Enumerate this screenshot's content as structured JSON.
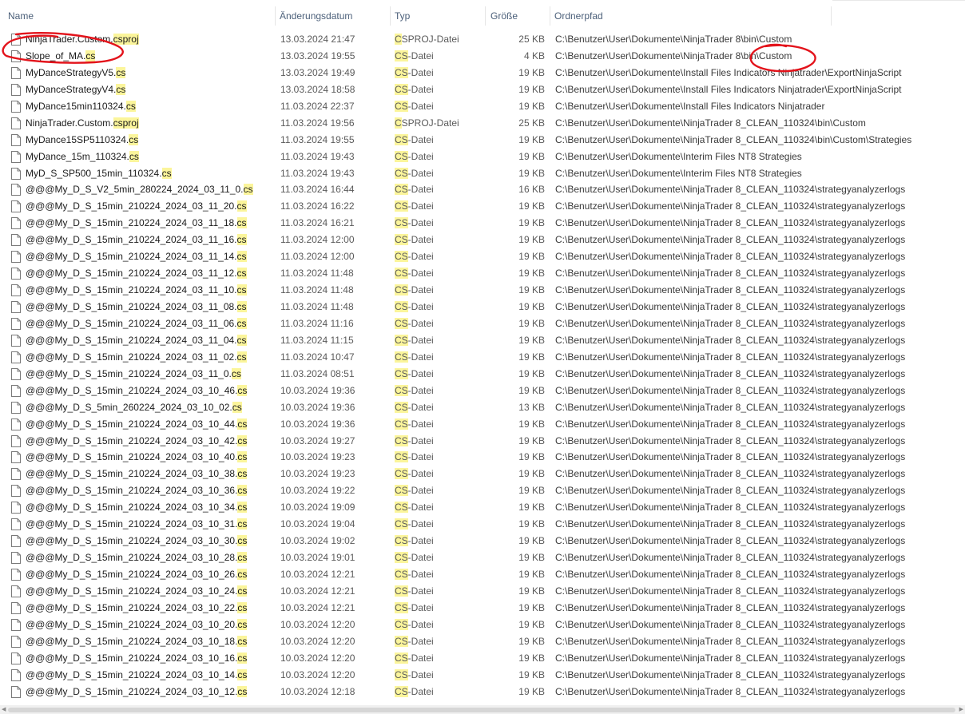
{
  "columns": {
    "name": "Name",
    "date": "Änderungsdatum",
    "type": "Typ",
    "size": "Größe",
    "path": "Ordnerpfad"
  },
  "files": [
    {
      "base": "NinjaTrader.Custom.",
      "ext": "csproj",
      "date": "13.03.2024 21:47",
      "type_hl": "C",
      "type_rest": "SPROJ-Datei",
      "size": "25 KB",
      "path": "C:\\Benutzer\\User\\Dokumente\\NinjaTrader 8\\bin\\Custom"
    },
    {
      "base": "Slope_of_MA.",
      "ext": "cs",
      "date": "13.03.2024 19:55",
      "type_hl": "CS",
      "type_rest": "-Datei",
      "size": "4 KB",
      "path": "C:\\Benutzer\\User\\Dokumente\\NinjaTrader 8\\bin\\Custom"
    },
    {
      "base": "MyDanceStrategyV5.",
      "ext": "cs",
      "date": "13.03.2024 19:49",
      "type_hl": "CS",
      "type_rest": "-Datei",
      "size": "19 KB",
      "path": "C:\\Benutzer\\User\\Dokumente\\Install Files Indicators Ninjatrader\\ExportNinjaScript"
    },
    {
      "base": "MyDanceStrategyV4.",
      "ext": "cs",
      "date": "13.03.2024 18:58",
      "type_hl": "CS",
      "type_rest": "-Datei",
      "size": "19 KB",
      "path": "C:\\Benutzer\\User\\Dokumente\\Install Files Indicators Ninjatrader\\ExportNinjaScript"
    },
    {
      "base": "MyDance15min110324.",
      "ext": "cs",
      "date": "11.03.2024 22:37",
      "type_hl": "CS",
      "type_rest": "-Datei",
      "size": "19 KB",
      "path": "C:\\Benutzer\\User\\Dokumente\\Install Files Indicators Ninjatrader"
    },
    {
      "base": "NinjaTrader.Custom.",
      "ext": "csproj",
      "date": "11.03.2024 19:56",
      "type_hl": "C",
      "type_rest": "SPROJ-Datei",
      "size": "25 KB",
      "path": "C:\\Benutzer\\User\\Dokumente\\NinjaTrader 8_CLEAN_110324\\bin\\Custom"
    },
    {
      "base": "MyDance15SP5110324.",
      "ext": "cs",
      "date": "11.03.2024 19:55",
      "type_hl": "CS",
      "type_rest": "-Datei",
      "size": "19 KB",
      "path": "C:\\Benutzer\\User\\Dokumente\\NinjaTrader 8_CLEAN_110324\\bin\\Custom\\Strategies"
    },
    {
      "base": "MyDance_15m_110324.",
      "ext": "cs",
      "date": "11.03.2024 19:43",
      "type_hl": "CS",
      "type_rest": "-Datei",
      "size": "19 KB",
      "path": "C:\\Benutzer\\User\\Dokumente\\Interim Files NT8 Strategies"
    },
    {
      "base": "MyD_S_SP500_15min_110324.",
      "ext": "cs",
      "date": "11.03.2024 19:43",
      "type_hl": "CS",
      "type_rest": "-Datei",
      "size": "19 KB",
      "path": "C:\\Benutzer\\User\\Dokumente\\Interim Files NT8 Strategies"
    },
    {
      "base": "@@@My_D_S_V2_5min_280224_2024_03_11_0.",
      "ext": "cs",
      "date": "11.03.2024 16:44",
      "type_hl": "CS",
      "type_rest": "-Datei",
      "size": "16 KB",
      "path": "C:\\Benutzer\\User\\Dokumente\\NinjaTrader 8_CLEAN_110324\\strategyanalyzerlogs"
    },
    {
      "base": "@@@My_D_S_15min_210224_2024_03_11_20.",
      "ext": "cs",
      "date": "11.03.2024 16:22",
      "type_hl": "CS",
      "type_rest": "-Datei",
      "size": "19 KB",
      "path": "C:\\Benutzer\\User\\Dokumente\\NinjaTrader 8_CLEAN_110324\\strategyanalyzerlogs"
    },
    {
      "base": "@@@My_D_S_15min_210224_2024_03_11_18.",
      "ext": "cs",
      "date": "11.03.2024 16:21",
      "type_hl": "CS",
      "type_rest": "-Datei",
      "size": "19 KB",
      "path": "C:\\Benutzer\\User\\Dokumente\\NinjaTrader 8_CLEAN_110324\\strategyanalyzerlogs"
    },
    {
      "base": "@@@My_D_S_15min_210224_2024_03_11_16.",
      "ext": "cs",
      "date": "11.03.2024 12:00",
      "type_hl": "CS",
      "type_rest": "-Datei",
      "size": "19 KB",
      "path": "C:\\Benutzer\\User\\Dokumente\\NinjaTrader 8_CLEAN_110324\\strategyanalyzerlogs"
    },
    {
      "base": "@@@My_D_S_15min_210224_2024_03_11_14.",
      "ext": "cs",
      "date": "11.03.2024 12:00",
      "type_hl": "CS",
      "type_rest": "-Datei",
      "size": "19 KB",
      "path": "C:\\Benutzer\\User\\Dokumente\\NinjaTrader 8_CLEAN_110324\\strategyanalyzerlogs"
    },
    {
      "base": "@@@My_D_S_15min_210224_2024_03_11_12.",
      "ext": "cs",
      "date": "11.03.2024 11:48",
      "type_hl": "CS",
      "type_rest": "-Datei",
      "size": "19 KB",
      "path": "C:\\Benutzer\\User\\Dokumente\\NinjaTrader 8_CLEAN_110324\\strategyanalyzerlogs"
    },
    {
      "base": "@@@My_D_S_15min_210224_2024_03_11_10.",
      "ext": "cs",
      "date": "11.03.2024 11:48",
      "type_hl": "CS",
      "type_rest": "-Datei",
      "size": "19 KB",
      "path": "C:\\Benutzer\\User\\Dokumente\\NinjaTrader 8_CLEAN_110324\\strategyanalyzerlogs"
    },
    {
      "base": "@@@My_D_S_15min_210224_2024_03_11_08.",
      "ext": "cs",
      "date": "11.03.2024 11:48",
      "type_hl": "CS",
      "type_rest": "-Datei",
      "size": "19 KB",
      "path": "C:\\Benutzer\\User\\Dokumente\\NinjaTrader 8_CLEAN_110324\\strategyanalyzerlogs"
    },
    {
      "base": "@@@My_D_S_15min_210224_2024_03_11_06.",
      "ext": "cs",
      "date": "11.03.2024 11:16",
      "type_hl": "CS",
      "type_rest": "-Datei",
      "size": "19 KB",
      "path": "C:\\Benutzer\\User\\Dokumente\\NinjaTrader 8_CLEAN_110324\\strategyanalyzerlogs"
    },
    {
      "base": "@@@My_D_S_15min_210224_2024_03_11_04.",
      "ext": "cs",
      "date": "11.03.2024 11:15",
      "type_hl": "CS",
      "type_rest": "-Datei",
      "size": "19 KB",
      "path": "C:\\Benutzer\\User\\Dokumente\\NinjaTrader 8_CLEAN_110324\\strategyanalyzerlogs"
    },
    {
      "base": "@@@My_D_S_15min_210224_2024_03_11_02.",
      "ext": "cs",
      "date": "11.03.2024 10:47",
      "type_hl": "CS",
      "type_rest": "-Datei",
      "size": "19 KB",
      "path": "C:\\Benutzer\\User\\Dokumente\\NinjaTrader 8_CLEAN_110324\\strategyanalyzerlogs"
    },
    {
      "base": "@@@My_D_S_15min_210224_2024_03_11_0.",
      "ext": "cs",
      "date": "11.03.2024 08:51",
      "type_hl": "CS",
      "type_rest": "-Datei",
      "size": "19 KB",
      "path": "C:\\Benutzer\\User\\Dokumente\\NinjaTrader 8_CLEAN_110324\\strategyanalyzerlogs"
    },
    {
      "base": "@@@My_D_S_15min_210224_2024_03_10_46.",
      "ext": "cs",
      "date": "10.03.2024 19:36",
      "type_hl": "CS",
      "type_rest": "-Datei",
      "size": "19 KB",
      "path": "C:\\Benutzer\\User\\Dokumente\\NinjaTrader 8_CLEAN_110324\\strategyanalyzerlogs"
    },
    {
      "base": "@@@My_D_S_5min_260224_2024_03_10_02.",
      "ext": "cs",
      "date": "10.03.2024 19:36",
      "type_hl": "CS",
      "type_rest": "-Datei",
      "size": "13 KB",
      "path": "C:\\Benutzer\\User\\Dokumente\\NinjaTrader 8_CLEAN_110324\\strategyanalyzerlogs"
    },
    {
      "base": "@@@My_D_S_15min_210224_2024_03_10_44.",
      "ext": "cs",
      "date": "10.03.2024 19:36",
      "type_hl": "CS",
      "type_rest": "-Datei",
      "size": "19 KB",
      "path": "C:\\Benutzer\\User\\Dokumente\\NinjaTrader 8_CLEAN_110324\\strategyanalyzerlogs"
    },
    {
      "base": "@@@My_D_S_15min_210224_2024_03_10_42.",
      "ext": "cs",
      "date": "10.03.2024 19:27",
      "type_hl": "CS",
      "type_rest": "-Datei",
      "size": "19 KB",
      "path": "C:\\Benutzer\\User\\Dokumente\\NinjaTrader 8_CLEAN_110324\\strategyanalyzerlogs"
    },
    {
      "base": "@@@My_D_S_15min_210224_2024_03_10_40.",
      "ext": "cs",
      "date": "10.03.2024 19:23",
      "type_hl": "CS",
      "type_rest": "-Datei",
      "size": "19 KB",
      "path": "C:\\Benutzer\\User\\Dokumente\\NinjaTrader 8_CLEAN_110324\\strategyanalyzerlogs"
    },
    {
      "base": "@@@My_D_S_15min_210224_2024_03_10_38.",
      "ext": "cs",
      "date": "10.03.2024 19:23",
      "type_hl": "CS",
      "type_rest": "-Datei",
      "size": "19 KB",
      "path": "C:\\Benutzer\\User\\Dokumente\\NinjaTrader 8_CLEAN_110324\\strategyanalyzerlogs"
    },
    {
      "base": "@@@My_D_S_15min_210224_2024_03_10_36.",
      "ext": "cs",
      "date": "10.03.2024 19:22",
      "type_hl": "CS",
      "type_rest": "-Datei",
      "size": "19 KB",
      "path": "C:\\Benutzer\\User\\Dokumente\\NinjaTrader 8_CLEAN_110324\\strategyanalyzerlogs"
    },
    {
      "base": "@@@My_D_S_15min_210224_2024_03_10_34.",
      "ext": "cs",
      "date": "10.03.2024 19:09",
      "type_hl": "CS",
      "type_rest": "-Datei",
      "size": "19 KB",
      "path": "C:\\Benutzer\\User\\Dokumente\\NinjaTrader 8_CLEAN_110324\\strategyanalyzerlogs"
    },
    {
      "base": "@@@My_D_S_15min_210224_2024_03_10_31.",
      "ext": "cs",
      "date": "10.03.2024 19:04",
      "type_hl": "CS",
      "type_rest": "-Datei",
      "size": "19 KB",
      "path": "C:\\Benutzer\\User\\Dokumente\\NinjaTrader 8_CLEAN_110324\\strategyanalyzerlogs"
    },
    {
      "base": "@@@My_D_S_15min_210224_2024_03_10_30.",
      "ext": "cs",
      "date": "10.03.2024 19:02",
      "type_hl": "CS",
      "type_rest": "-Datei",
      "size": "19 KB",
      "path": "C:\\Benutzer\\User\\Dokumente\\NinjaTrader 8_CLEAN_110324\\strategyanalyzerlogs"
    },
    {
      "base": "@@@My_D_S_15min_210224_2024_03_10_28.",
      "ext": "cs",
      "date": "10.03.2024 19:01",
      "type_hl": "CS",
      "type_rest": "-Datei",
      "size": "19 KB",
      "path": "C:\\Benutzer\\User\\Dokumente\\NinjaTrader 8_CLEAN_110324\\strategyanalyzerlogs"
    },
    {
      "base": "@@@My_D_S_15min_210224_2024_03_10_26.",
      "ext": "cs",
      "date": "10.03.2024 12:21",
      "type_hl": "CS",
      "type_rest": "-Datei",
      "size": "19 KB",
      "path": "C:\\Benutzer\\User\\Dokumente\\NinjaTrader 8_CLEAN_110324\\strategyanalyzerlogs"
    },
    {
      "base": "@@@My_D_S_15min_210224_2024_03_10_24.",
      "ext": "cs",
      "date": "10.03.2024 12:21",
      "type_hl": "CS",
      "type_rest": "-Datei",
      "size": "19 KB",
      "path": "C:\\Benutzer\\User\\Dokumente\\NinjaTrader 8_CLEAN_110324\\strategyanalyzerlogs"
    },
    {
      "base": "@@@My_D_S_15min_210224_2024_03_10_22.",
      "ext": "cs",
      "date": "10.03.2024 12:21",
      "type_hl": "CS",
      "type_rest": "-Datei",
      "size": "19 KB",
      "path": "C:\\Benutzer\\User\\Dokumente\\NinjaTrader 8_CLEAN_110324\\strategyanalyzerlogs"
    },
    {
      "base": "@@@My_D_S_15min_210224_2024_03_10_20.",
      "ext": "cs",
      "date": "10.03.2024 12:20",
      "type_hl": "CS",
      "type_rest": "-Datei",
      "size": "19 KB",
      "path": "C:\\Benutzer\\User\\Dokumente\\NinjaTrader 8_CLEAN_110324\\strategyanalyzerlogs"
    },
    {
      "base": "@@@My_D_S_15min_210224_2024_03_10_18.",
      "ext": "cs",
      "date": "10.03.2024 12:20",
      "type_hl": "CS",
      "type_rest": "-Datei",
      "size": "19 KB",
      "path": "C:\\Benutzer\\User\\Dokumente\\NinjaTrader 8_CLEAN_110324\\strategyanalyzerlogs"
    },
    {
      "base": "@@@My_D_S_15min_210224_2024_03_10_16.",
      "ext": "cs",
      "date": "10.03.2024 12:20",
      "type_hl": "CS",
      "type_rest": "-Datei",
      "size": "19 KB",
      "path": "C:\\Benutzer\\User\\Dokumente\\NinjaTrader 8_CLEAN_110324\\strategyanalyzerlogs"
    },
    {
      "base": "@@@My_D_S_15min_210224_2024_03_10_14.",
      "ext": "cs",
      "date": "10.03.2024 12:20",
      "type_hl": "CS",
      "type_rest": "-Datei",
      "size": "19 KB",
      "path": "C:\\Benutzer\\User\\Dokumente\\NinjaTrader 8_CLEAN_110324\\strategyanalyzerlogs"
    },
    {
      "base": "@@@My_D_S_15min_210224_2024_03_10_12.",
      "ext": "cs",
      "date": "10.03.2024 12:18",
      "type_hl": "CS",
      "type_rest": "-Datei",
      "size": "19 KB",
      "path": "C:\\Benutzer\\User\\Dokumente\\NinjaTrader 8_CLEAN_110324\\strategyanalyzerlogs"
    }
  ],
  "colors": {
    "highlight": "#fbf59b",
    "annotation": "#e3131b",
    "header_text": "#4c607a"
  },
  "icons": {
    "file": "file-icon",
    "scroll_left": "scroll-left-icon",
    "scroll_right": "scroll-right-icon"
  }
}
